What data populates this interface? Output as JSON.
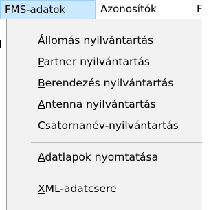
{
  "menubar": {
    "items": [
      {
        "label": "FMS-adatok"
      },
      {
        "label": "Azonosítók"
      },
      {
        "label": "F"
      }
    ]
  },
  "dropdown": {
    "items": [
      {
        "pre": "Állomás ",
        "mn": "n",
        "post": "yilvántartás"
      },
      {
        "pre": "",
        "mn": "P",
        "post": "artner nyilvántartás"
      },
      {
        "pre": "",
        "mn": "B",
        "post": "erendezés nyilvántartás"
      },
      {
        "pre": "",
        "mn": "A",
        "post": "ntenna nyilvántartás"
      },
      {
        "pre": "",
        "mn": "C",
        "post": "satornanév-nyilvántartás"
      },
      {
        "pre": "",
        "mn": "A",
        "post": "datlapok nyomtatása"
      },
      {
        "pre": "",
        "mn": "X",
        "post": "ML-adatcsere"
      }
    ]
  },
  "colors": {
    "active_menu_bg": "#cce8ff",
    "active_menu_border": "#99d1ff",
    "dropdown_bg": "#f2f2f2"
  }
}
